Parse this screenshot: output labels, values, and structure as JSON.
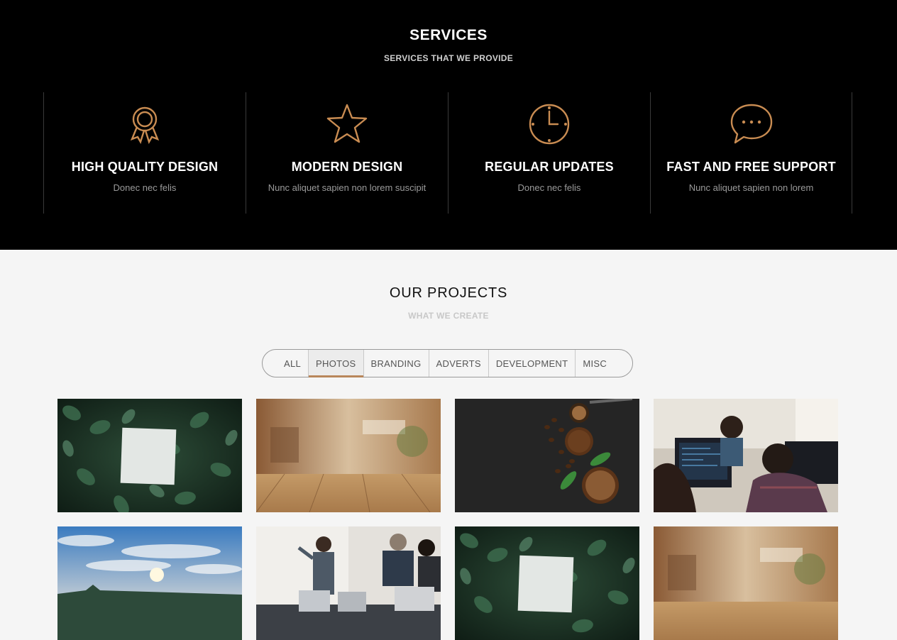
{
  "services": {
    "title": "SERVICES",
    "subtitle": "SERVICES THAT WE PROVIDE",
    "accent_color": "#c98c52",
    "items": [
      {
        "icon": "award-ribbon-icon",
        "name": "HIGH QUALITY DESIGN",
        "desc": "Donec nec felis"
      },
      {
        "icon": "star-icon",
        "name": "MODERN DESIGN",
        "desc": "Nunc aliquet sapien non lorem suscipit"
      },
      {
        "icon": "clock-icon",
        "name": "REGULAR UPDATES",
        "desc": "Donec nec felis"
      },
      {
        "icon": "chat-bubble-icon",
        "name": "FAST AND FREE SUPPORT",
        "desc": "Nunc aliquet sapien non lorem"
      }
    ]
  },
  "projects": {
    "title": "OUR PROJECTS",
    "subtitle": "WHAT WE CREATE",
    "filters": [
      "ALL",
      "PHOTOS",
      "BRANDING",
      "ADVERTS",
      "DEVELOPMENT",
      "MISC"
    ],
    "active_filter": "PHOTOS",
    "tiles": [
      {
        "subject": "white card on green leaves"
      },
      {
        "subject": "wooden table with blurred cafe"
      },
      {
        "subject": "coffee beans on dark slate"
      },
      {
        "subject": "people working at computers"
      },
      {
        "subject": "sky with sunset clouds"
      },
      {
        "subject": "business presentation meeting"
      },
      {
        "subject": "white card on green leaves"
      },
      {
        "subject": "wooden table with blurred cafe"
      }
    ]
  }
}
